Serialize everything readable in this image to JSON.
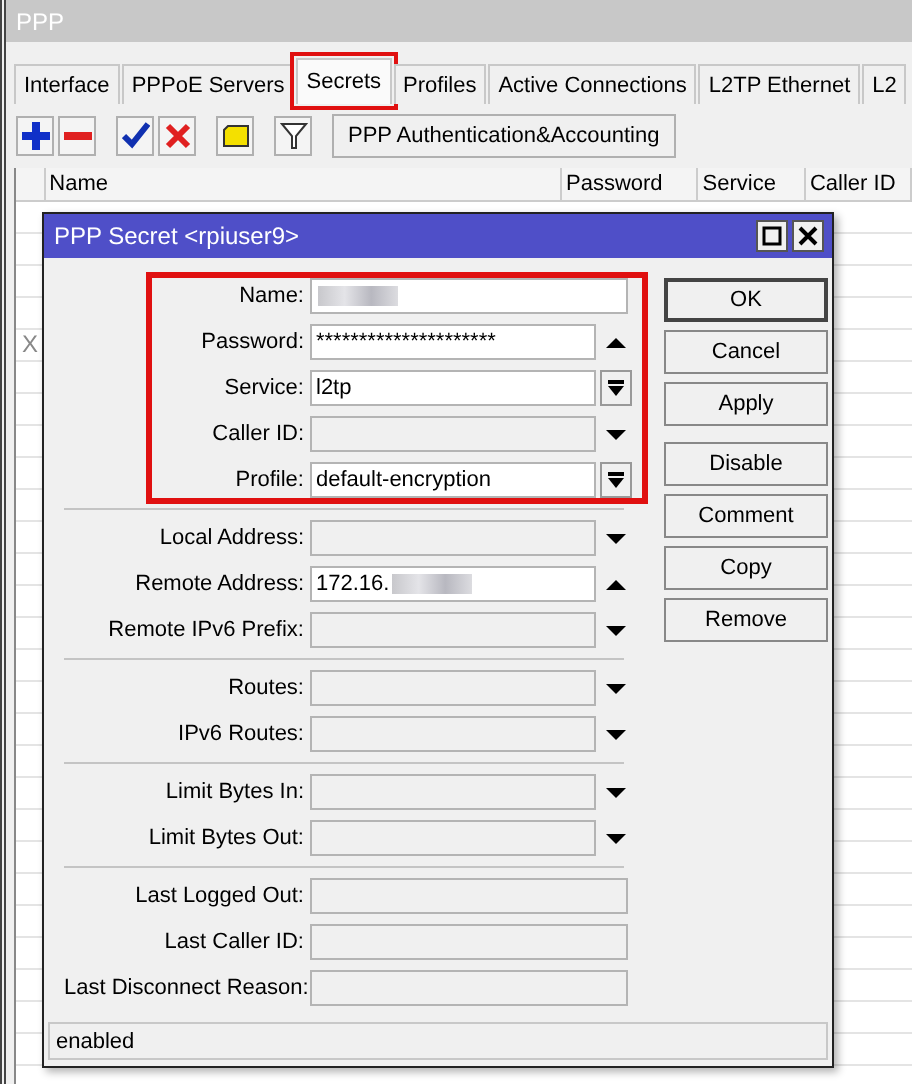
{
  "window": {
    "title": "PPP"
  },
  "tabs": [
    {
      "label": "Interface",
      "selected": false,
      "highlighted": false
    },
    {
      "label": "PPPoE Servers",
      "selected": false,
      "highlighted": false
    },
    {
      "label": "Secrets",
      "selected": true,
      "highlighted": true
    },
    {
      "label": "Profiles",
      "selected": false,
      "highlighted": false
    },
    {
      "label": "Active Connections",
      "selected": false,
      "highlighted": false
    },
    {
      "label": "L2TP Ethernet",
      "selected": false,
      "highlighted": false
    },
    {
      "label": "L2",
      "selected": false,
      "highlighted": false
    }
  ],
  "toolbar": {
    "buttons": [
      {
        "kind": "add"
      },
      {
        "kind": "remove"
      },
      {
        "kind": "enable"
      },
      {
        "kind": "disable"
      },
      {
        "kind": "comment"
      },
      {
        "kind": "filter"
      }
    ],
    "auth_button": "PPP Authentication&Accounting"
  },
  "table": {
    "columns": [
      "Name",
      "Password",
      "Service",
      "Caller ID"
    ],
    "disabled_mark": "X"
  },
  "dialog": {
    "title": "PPP Secret <rpiuser9>",
    "groups": [
      {
        "highlighted": true,
        "fields": [
          {
            "label": "Name:",
            "redacted": true,
            "kind": "plain"
          },
          {
            "label": "Password:",
            "value": "*********************",
            "redacted": false,
            "kind": "up"
          },
          {
            "label": "Service:",
            "value": "l2tp",
            "redacted": false,
            "kind": "select"
          },
          {
            "label": "Caller ID:",
            "redacted": false,
            "kind": "down"
          },
          {
            "label": "Profile:",
            "value": "default-encryption",
            "redacted": false,
            "kind": "select"
          }
        ]
      },
      {
        "highlighted": false,
        "fields": [
          {
            "label": "Local Address:",
            "redacted": false,
            "kind": "down"
          },
          {
            "label": "Remote Address:",
            "value": "172.16.",
            "redacted": true,
            "kind": "up"
          },
          {
            "label": "Remote IPv6 Prefix:",
            "redacted": false,
            "kind": "down"
          }
        ]
      },
      {
        "highlighted": false,
        "fields": [
          {
            "label": "Routes:",
            "redacted": false,
            "kind": "down"
          },
          {
            "label": "IPv6 Routes:",
            "redacted": false,
            "kind": "down"
          }
        ]
      },
      {
        "highlighted": false,
        "fields": [
          {
            "label": "Limit Bytes In:",
            "redacted": false,
            "kind": "down"
          },
          {
            "label": "Limit Bytes Out:",
            "redacted": false,
            "kind": "down"
          }
        ]
      },
      {
        "highlighted": false,
        "fields": [
          {
            "label": "Last Logged Out:",
            "redacted": false,
            "kind": "plain"
          },
          {
            "label": "Last Caller ID:",
            "redacted": false,
            "kind": "plain"
          },
          {
            "label": "Last Disconnect Reason:",
            "redacted": false,
            "kind": "plain"
          }
        ]
      }
    ],
    "button_groups": [
      [
        {
          "label": "OK",
          "default": true
        },
        {
          "label": "Cancel",
          "default": false
        },
        {
          "label": "Apply",
          "default": false
        }
      ],
      [
        {
          "label": "Disable",
          "default": false
        },
        {
          "label": "Comment",
          "default": false
        },
        {
          "label": "Copy",
          "default": false
        },
        {
          "label": "Remove",
          "default": false
        }
      ]
    ],
    "status": "enabled"
  }
}
